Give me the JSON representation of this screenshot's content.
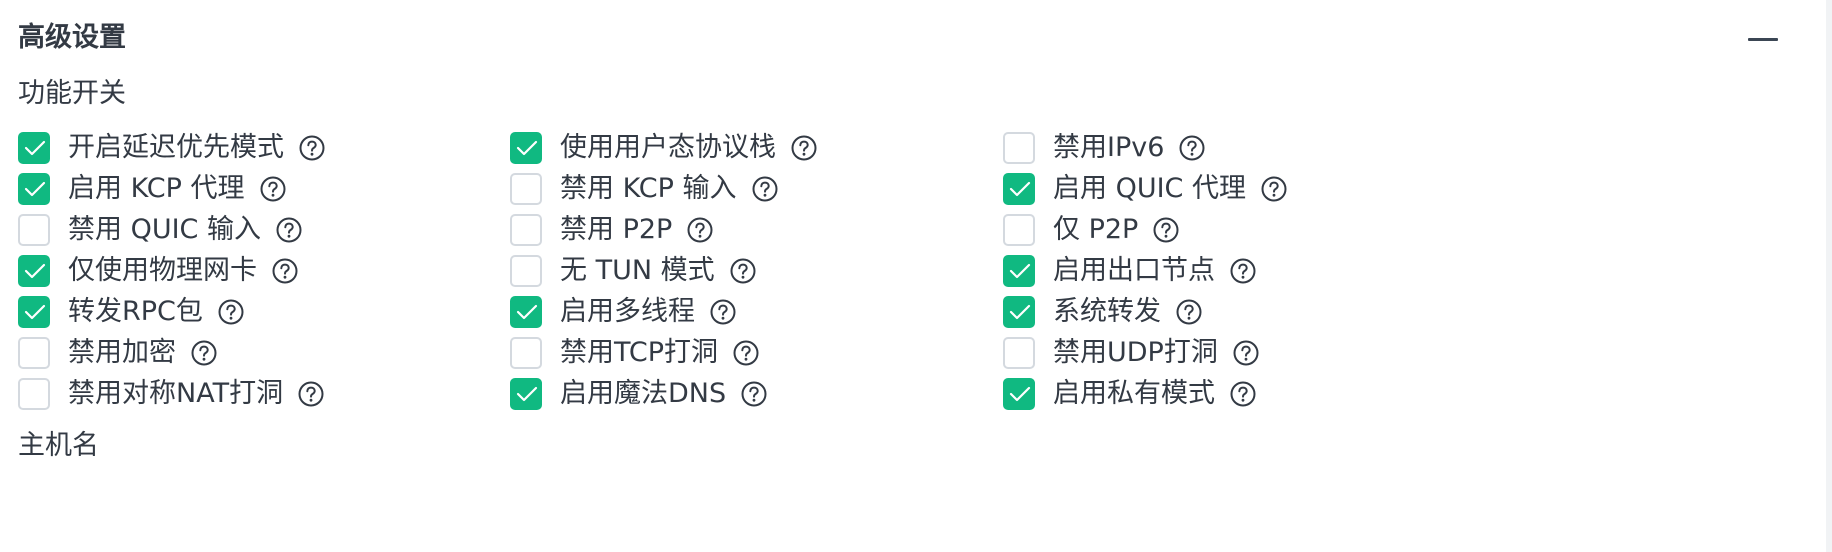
{
  "panel": {
    "title": "高级设置",
    "collapse_icon": "minus-icon"
  },
  "sections": {
    "features": "功能开关",
    "hostname": "主机名"
  },
  "colors": {
    "accent": "#10b981",
    "text": "#333a44",
    "border": "#d4d9df"
  },
  "help_icon": "question-circle-icon",
  "options": [
    [
      {
        "label": "开启延迟优先模式",
        "checked": true
      },
      {
        "label": "使用用户态协议栈",
        "checked": true
      },
      {
        "label": "禁用IPv6",
        "checked": false
      }
    ],
    [
      {
        "label": "启用 KCP 代理",
        "checked": true
      },
      {
        "label": "禁用 KCP 输入",
        "checked": false
      },
      {
        "label": "启用 QUIC 代理",
        "checked": true
      }
    ],
    [
      {
        "label": "禁用 QUIC 输入",
        "checked": false
      },
      {
        "label": "禁用 P2P",
        "checked": false
      },
      {
        "label": "仅 P2P",
        "checked": false
      }
    ],
    [
      {
        "label": "仅使用物理网卡",
        "checked": true
      },
      {
        "label": "无 TUN 模式",
        "checked": false
      },
      {
        "label": "启用出口节点",
        "checked": true
      }
    ],
    [
      {
        "label": "转发RPC包",
        "checked": true
      },
      {
        "label": "启用多线程",
        "checked": true
      },
      {
        "label": "系统转发",
        "checked": true
      }
    ],
    [
      {
        "label": "禁用加密",
        "checked": false
      },
      {
        "label": "禁用TCP打洞",
        "checked": false
      },
      {
        "label": "禁用UDP打洞",
        "checked": false
      }
    ],
    [
      {
        "label": "禁用对称NAT打洞",
        "checked": false
      },
      {
        "label": "启用魔法DNS",
        "checked": true
      },
      {
        "label": "启用私有模式",
        "checked": true
      }
    ]
  ]
}
